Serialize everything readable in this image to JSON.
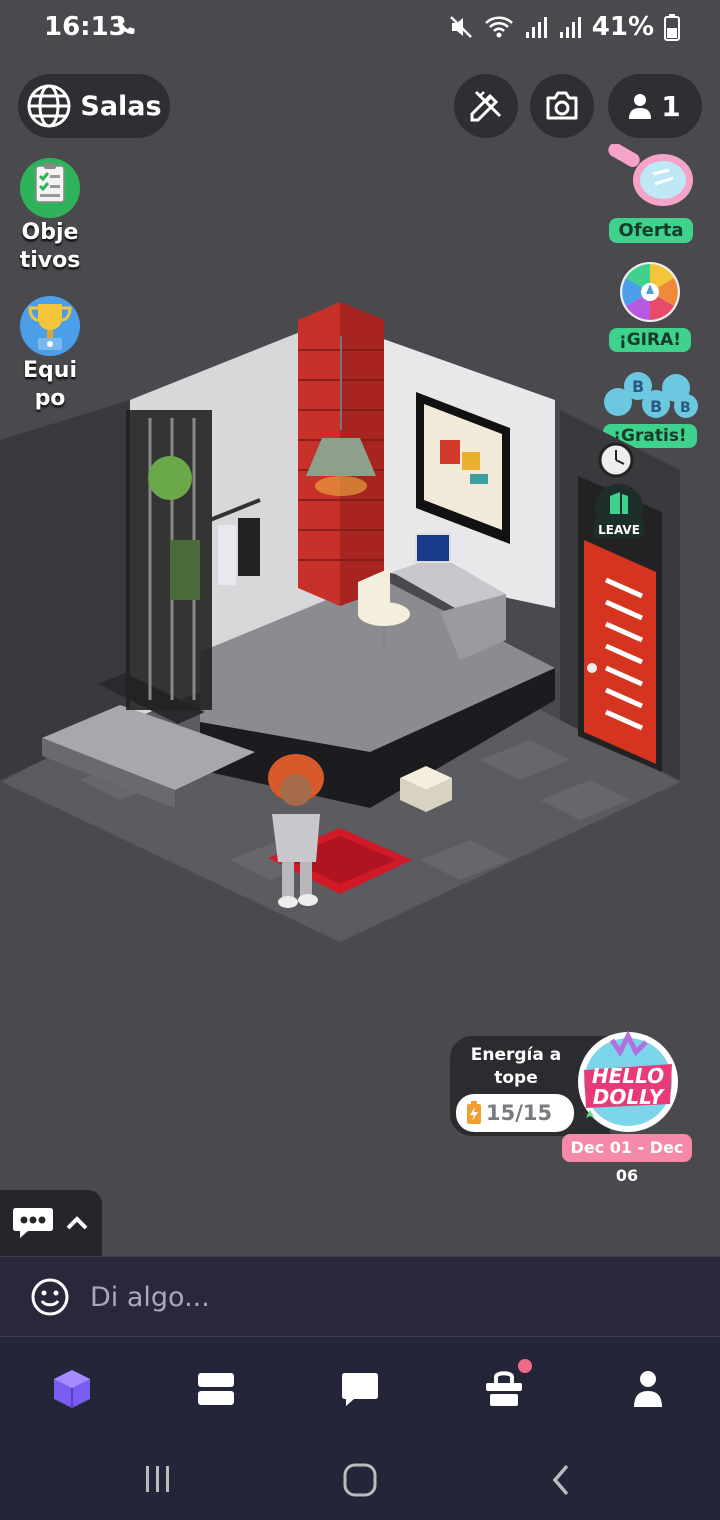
{
  "status_bar": {
    "time": "16:13",
    "battery": "41%"
  },
  "top_bar": {
    "rooms_label": "Salas",
    "users_count": "1"
  },
  "side_left": [
    {
      "label_line1": "Obje",
      "label_line2": "tivos",
      "icon": "clipboard-icon"
    },
    {
      "label_line1": "Equi",
      "label_line2": "po",
      "icon": "trophy-icon"
    }
  ],
  "side_right": {
    "offer_label": "Oferta",
    "spin_label": "¡GIRA!",
    "free_label": "¡Gratis!",
    "leave_label": "LEAVE"
  },
  "event": {
    "title": "Energía a tope",
    "energy": "15/15",
    "logo_text": "HELLO DOLLY",
    "dates": "Dec 01 - Dec 06"
  },
  "chat": {
    "placeholder": "Di algo..."
  },
  "colors": {
    "background": "#4a4a4e",
    "button_bg": "#2f2f33",
    "accent_green": "#3fd28c",
    "accent_purple": "#7b5cf0",
    "nav_bg": "#25253a",
    "notification_dot": "#f06a8c"
  },
  "bottom_nav": [
    "room-icon",
    "catalog-icon",
    "chat-icon",
    "shop-icon",
    "profile-icon"
  ]
}
